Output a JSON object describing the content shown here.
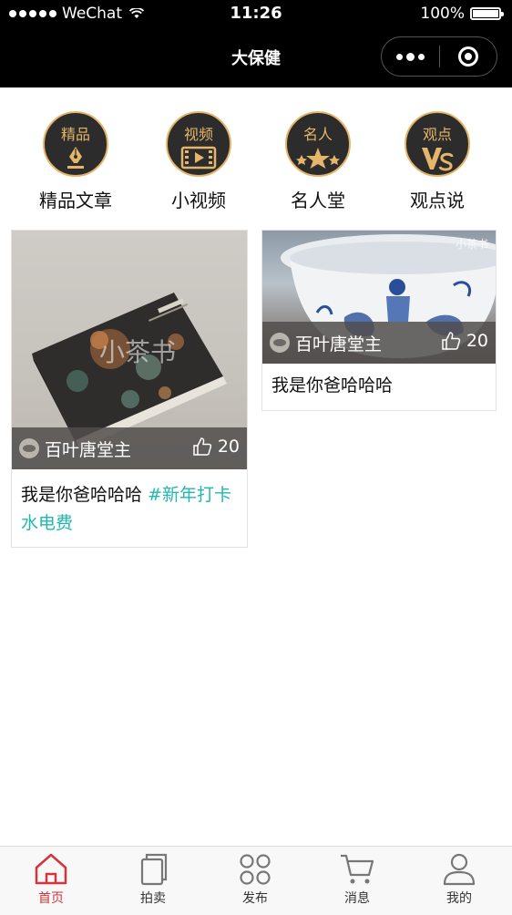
{
  "status_bar": {
    "carrier": "WeChat",
    "time": "11:26",
    "battery": "100%"
  },
  "nav": {
    "title": "大保健"
  },
  "categories": [
    {
      "badge": "精品",
      "label": "精品文章",
      "icon": "pen-nib-icon"
    },
    {
      "badge": "视频",
      "label": "小视频",
      "icon": "film-play-icon"
    },
    {
      "badge": "名人",
      "label": "名人堂",
      "icon": "stars-icon"
    },
    {
      "badge": "观点",
      "label": "观点说",
      "icon": "vs-icon"
    }
  ],
  "cards": [
    {
      "author": "百叶唐堂主",
      "likes": "20",
      "caption": "我是你爸哈哈哈 ",
      "tag": "#新年打卡水电费",
      "image": "book-cover-photo"
    },
    {
      "author": "百叶唐堂主",
      "likes": "20",
      "caption": "我是你爸哈哈哈",
      "image": "porcelain-bowl-photo"
    }
  ],
  "watermark": "小茶书",
  "tabbar": [
    {
      "label": "首页",
      "icon": "home-icon",
      "active": true
    },
    {
      "label": "拍卖",
      "icon": "cards-icon",
      "active": false
    },
    {
      "label": "发布",
      "icon": "grid-circles-icon",
      "active": false
    },
    {
      "label": "消息",
      "icon": "cart-icon",
      "active": false
    },
    {
      "label": "我的",
      "icon": "user-icon",
      "active": false
    }
  ],
  "colors": {
    "accent_gold": "#e5b56a",
    "tag_teal": "#21b7b0",
    "tab_active": "#d4343b",
    "tab_inactive": "#777777"
  }
}
